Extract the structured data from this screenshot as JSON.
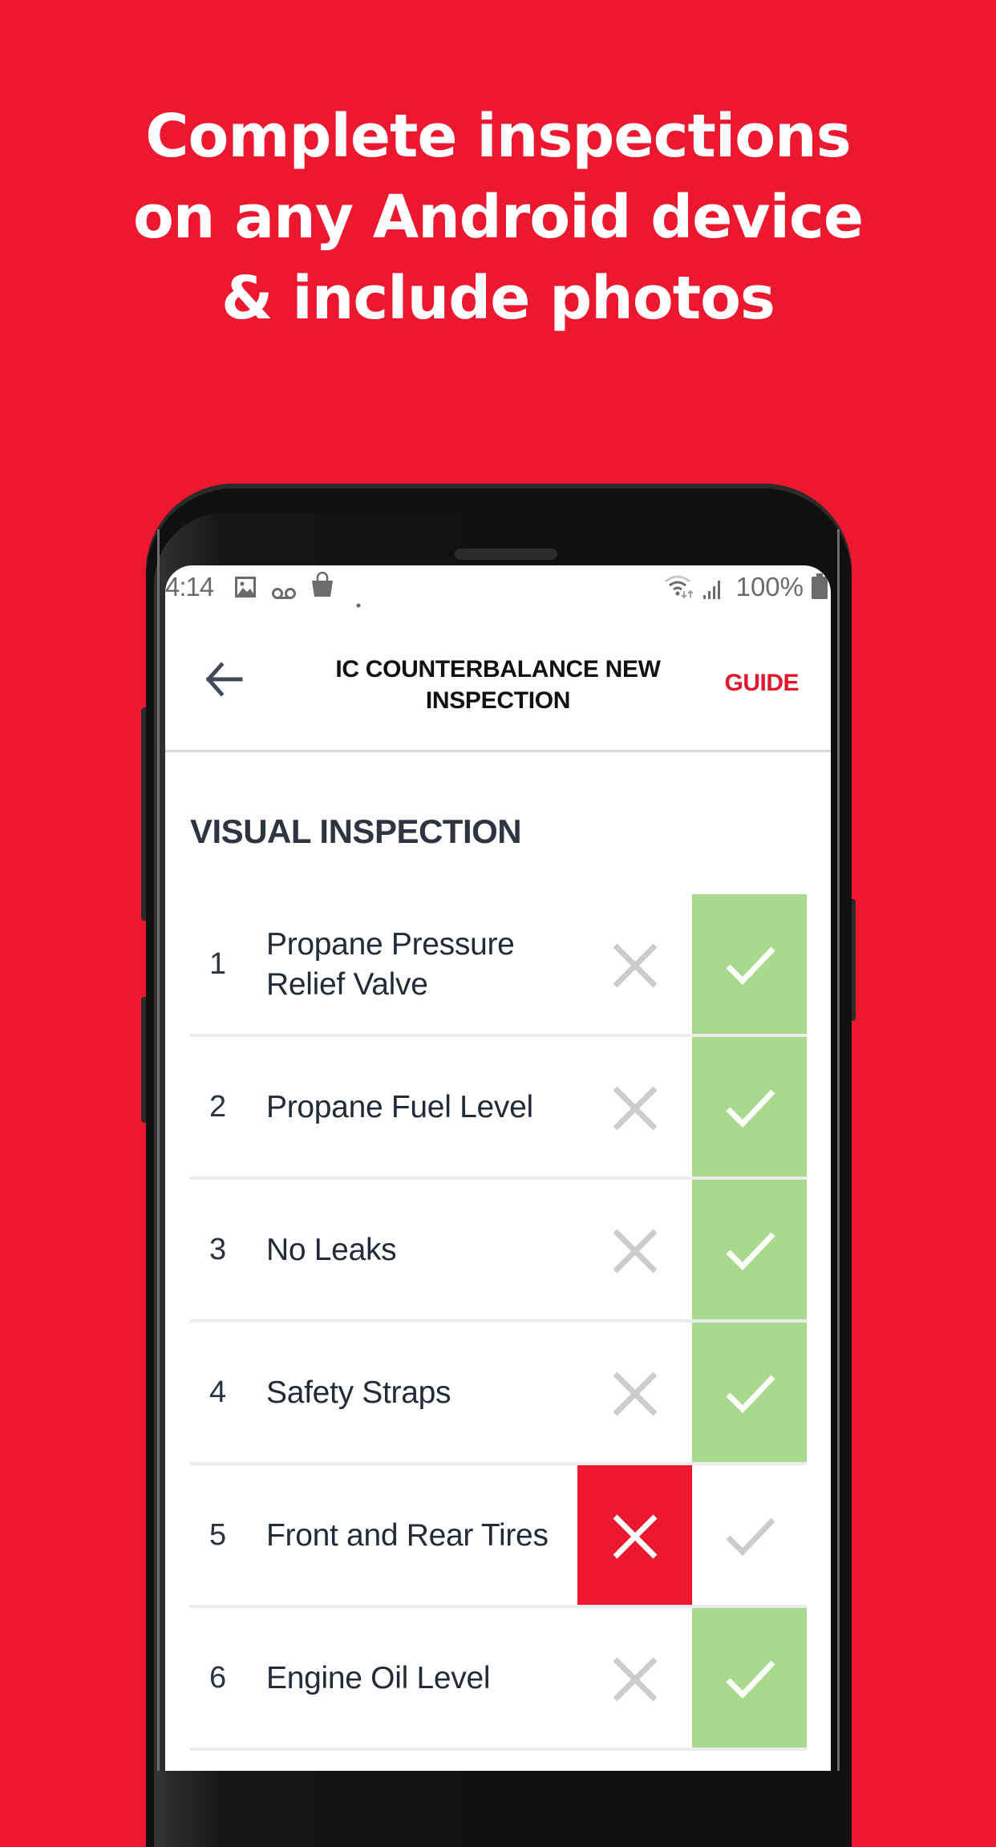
{
  "headline": {
    "lines": [
      "Complete inspections",
      "on any Android device",
      "& include photos"
    ]
  },
  "colors": {
    "brand_red": "#EC1830",
    "pass_green": "#A9D98C",
    "inactive_gray": "#CCCCCC",
    "text_dark": "#232B38"
  },
  "status_bar": {
    "time": "4:14",
    "left_icons": [
      "image-icon",
      "voicemail-icon",
      "shopping-bag-icon",
      "dot-icon"
    ],
    "right_icons": [
      "wifi-icon",
      "signal-icon",
      "battery-icon"
    ],
    "battery": "100%"
  },
  "app_bar": {
    "back_icon": "arrow-left-icon",
    "title_line1": "IC COUNTERBALANCE NEW",
    "title_line2": "INSPECTION",
    "guide_label": "GUIDE"
  },
  "section": {
    "title": "VISUAL INSPECTION"
  },
  "items": [
    {
      "number": "1",
      "label": "Propane Pressure Relief Valve",
      "status": "pass"
    },
    {
      "number": "2",
      "label": "Propane Fuel Level",
      "status": "pass"
    },
    {
      "number": "3",
      "label": "No Leaks",
      "status": "pass"
    },
    {
      "number": "4",
      "label": "Safety Straps",
      "status": "pass"
    },
    {
      "number": "5",
      "label": "Front and Rear Tires",
      "status": "fail"
    },
    {
      "number": "6",
      "label": "Engine Oil Level",
      "status": "pass"
    }
  ]
}
